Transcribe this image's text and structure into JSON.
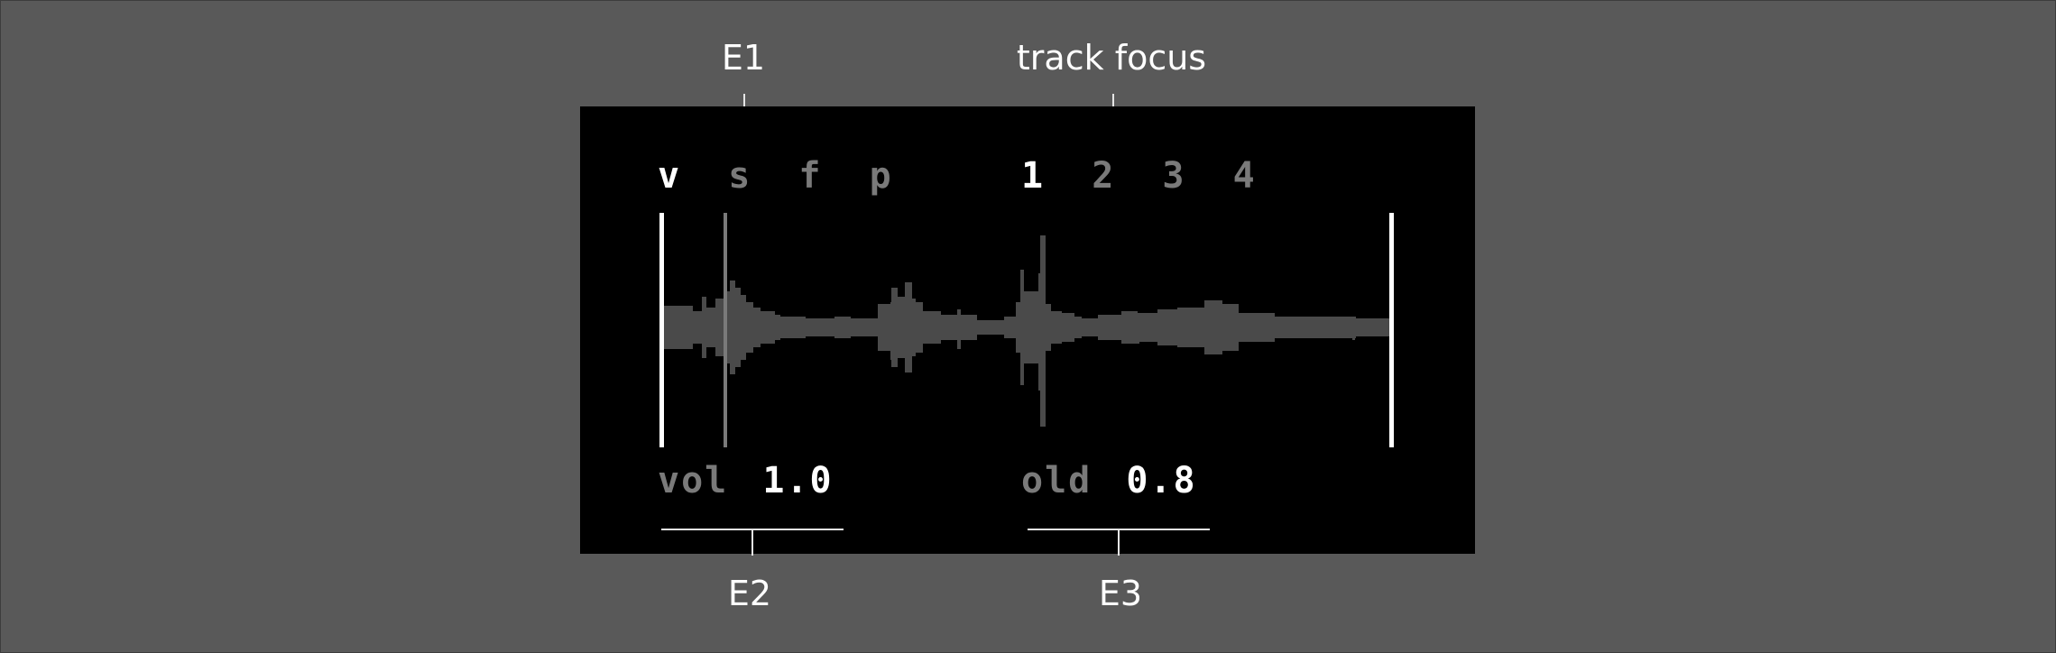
{
  "callouts": {
    "e1": "E1",
    "track_focus": "track focus",
    "e2": "E2",
    "e3": "E3"
  },
  "screen": {
    "modes": [
      "v",
      "s",
      "f",
      "p"
    ],
    "active_mode": "v",
    "tracks": [
      "1",
      "2",
      "3",
      "4"
    ],
    "active_track": "1",
    "param1_label": "vol",
    "param1_value": "1.0",
    "param2_label": "old",
    "param2_value": "0.8"
  },
  "colors": {
    "background": "#595959",
    "screen": "#000000",
    "waveform": "#4a4a4a",
    "marker": "#ffffff",
    "playhead": "#7a7a7a",
    "dim_text": "#7a7a7a",
    "bright_text": "#ffffff"
  }
}
